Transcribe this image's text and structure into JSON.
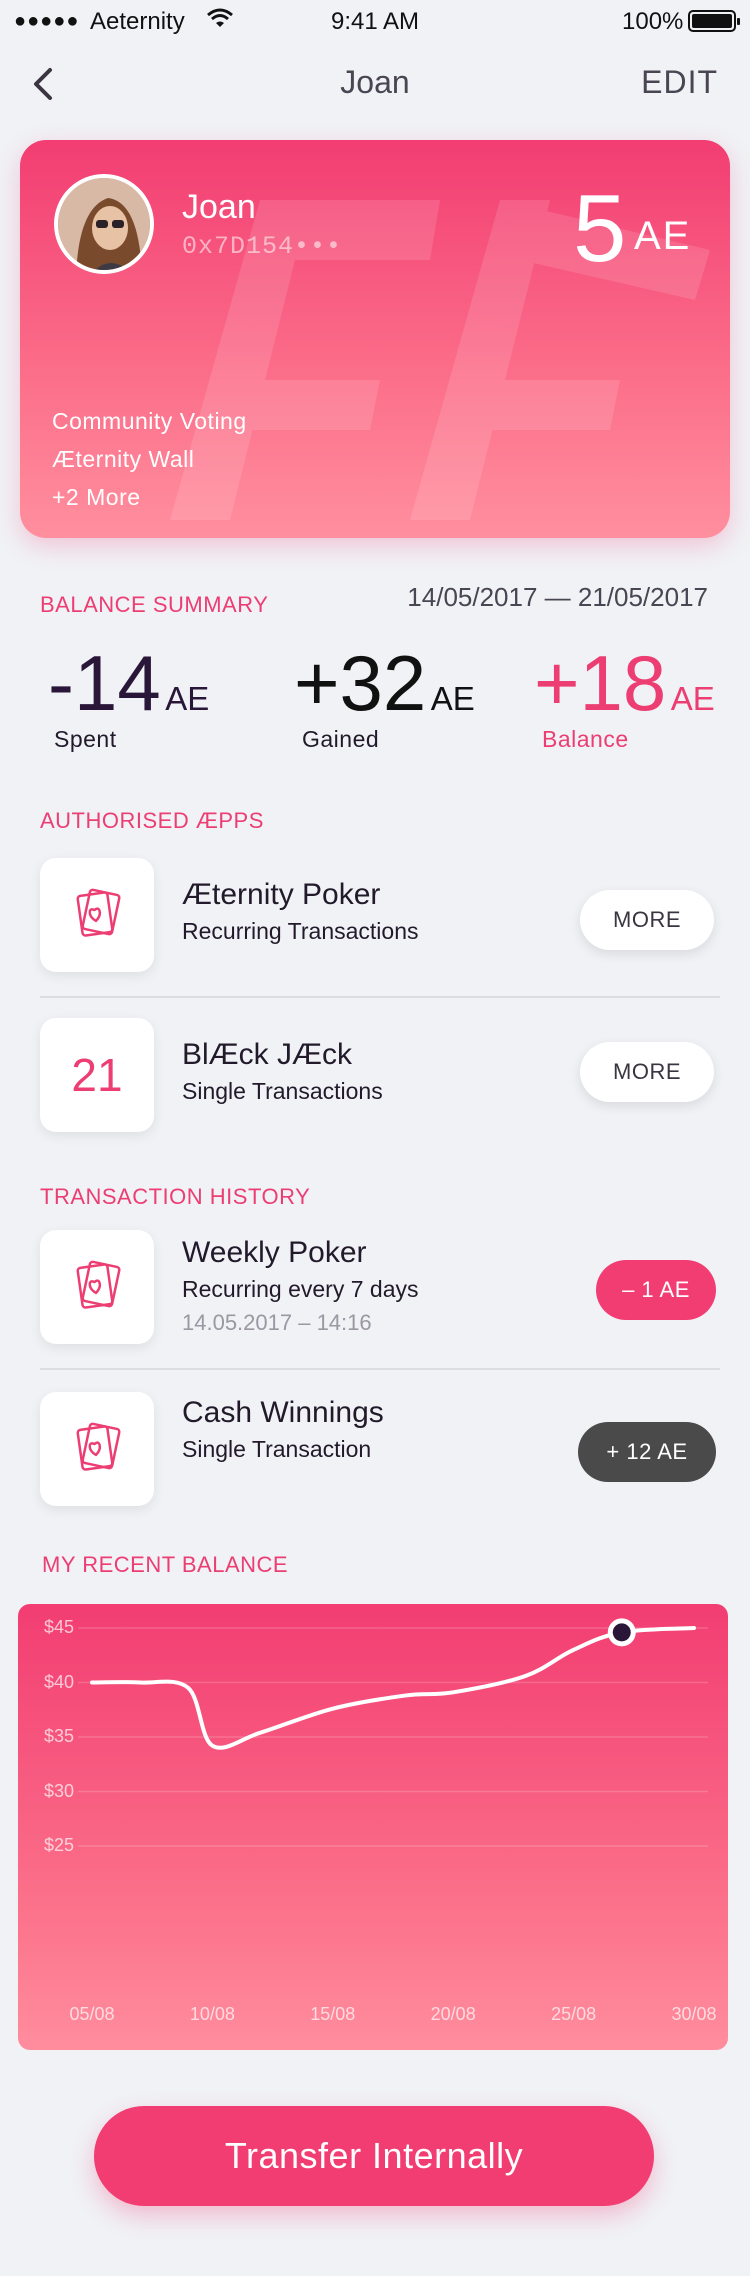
{
  "status_bar": {
    "signal": "●●●●●",
    "carrier": "Aeternity",
    "time": "9:41 AM",
    "battery": "100%"
  },
  "nav": {
    "title": "Joan",
    "edit_label": "EDIT"
  },
  "profile": {
    "name": "Joan",
    "address": "0x7D154•••",
    "balance_value": "5",
    "balance_unit": "AE",
    "apps": [
      "Community Voting",
      "Æternity Wall",
      "+2 More"
    ]
  },
  "balance_summary": {
    "heading": "BALANCE SUMMARY",
    "date_range": "14/05/2017 — 21/05/2017",
    "stats": [
      {
        "value": "-14",
        "unit": "AE",
        "label": "Spent",
        "color": "#2a1638"
      },
      {
        "value": "+32",
        "unit": "AE",
        "label": "Gained",
        "color": "#111111"
      },
      {
        "value": "+18",
        "unit": "AE",
        "label": "Balance",
        "color": "#ec3e73"
      }
    ]
  },
  "authorised_apps": {
    "heading": "AUTHORISED ÆPPS",
    "items": [
      {
        "icon": "cards-icon",
        "title": "Æternity Poker",
        "subtitle": "Recurring Transactions",
        "button": "MORE"
      },
      {
        "icon_text": "21",
        "title": "BlÆck JÆck",
        "subtitle": "Single Transactions",
        "button": "MORE"
      }
    ]
  },
  "transaction_history": {
    "heading": "TRANSACTION HISTORY",
    "items": [
      {
        "icon": "cards-icon",
        "title": "Weekly Poker",
        "subtitle": "Recurring every 7 days",
        "date": "14.05.2017 – 14:16",
        "amount": "– 1 AE"
      },
      {
        "icon": "cards-icon",
        "title": "Cash Winnings",
        "subtitle": "Single Transaction",
        "amount": "+ 12 AE"
      }
    ]
  },
  "recent_balance": {
    "heading": "MY RECENT BALANCE"
  },
  "chart_data": {
    "type": "line",
    "title": "",
    "xlabel": "",
    "ylabel": "",
    "x": [
      "05/08",
      "07/08",
      "09/08",
      "10/08",
      "12/08",
      "15/08",
      "18/08",
      "20/08",
      "23/08",
      "25/08",
      "27/08",
      "30/08"
    ],
    "y": [
      40,
      40,
      39.5,
      34.2,
      35.4,
      37.6,
      38.8,
      39.1,
      40.6,
      43.0,
      44.6,
      45.0
    ],
    "x_ticks": [
      "05/08",
      "10/08",
      "15/08",
      "20/08",
      "25/08",
      "30/08"
    ],
    "y_ticks": [
      "$45",
      "$40",
      "$35",
      "$30",
      "$25"
    ],
    "ylim": [
      23,
      47
    ],
    "highlight_index": 10,
    "grid": true,
    "colors": {
      "line": "#ffffff",
      "marker": "#2a1638"
    }
  },
  "actions": {
    "transfer_label": "Transfer Internally"
  },
  "colors": {
    "accent": "#f23d72",
    "dark_pill": "#4a4a4a",
    "background": "#f0f2f6"
  }
}
